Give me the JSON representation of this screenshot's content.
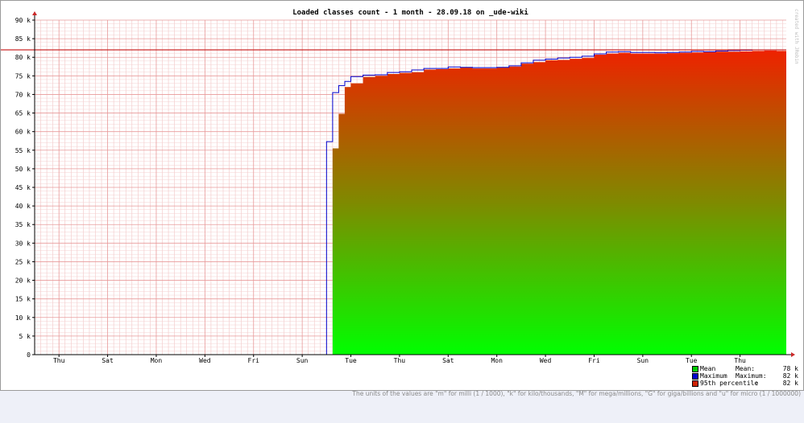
{
  "chart_data": {
    "type": "area",
    "title": "Loaded classes count - 1 month - 28.09.18 on _ude-wiki",
    "xlabel": "",
    "ylabel": "",
    "ylim": [
      0,
      90000
    ],
    "y_ticks": [
      0,
      5000,
      10000,
      15000,
      20000,
      25000,
      30000,
      35000,
      40000,
      45000,
      50000,
      55000,
      60000,
      65000,
      70000,
      75000,
      80000,
      85000,
      90000
    ],
    "y_tick_labels": [
      "0",
      "5 k",
      "10 k",
      "15 k",
      "20 k",
      "25 k",
      "30 k",
      "35 k",
      "40 k",
      "45 k",
      "50 k",
      "55 k",
      "60 k",
      "65 k",
      "70 k",
      "75 k",
      "80 k",
      "85 k",
      "90 k"
    ],
    "x_range_days": [
      0,
      30.9
    ],
    "x_ticks": [
      {
        "day": 1,
        "label": "Thu"
      },
      {
        "day": 3,
        "label": "Sat"
      },
      {
        "day": 5,
        "label": "Mon"
      },
      {
        "day": 7,
        "label": "Wed"
      },
      {
        "day": 9,
        "label": "Fri"
      },
      {
        "day": 11,
        "label": "Sun"
      },
      {
        "day": 13,
        "label": "Tue"
      },
      {
        "day": 15,
        "label": "Thu"
      },
      {
        "day": 17,
        "label": "Sat"
      },
      {
        "day": 19,
        "label": "Mon"
      },
      {
        "day": 21,
        "label": "Wed"
      },
      {
        "day": 23,
        "label": "Fri"
      },
      {
        "day": 25,
        "label": "Sun"
      },
      {
        "day": 27,
        "label": "Tue"
      },
      {
        "day": 29,
        "label": "Thu"
      }
    ],
    "percentile_95": 82000,
    "series": [
      {
        "name": "Mean",
        "color": "#00cc00",
        "x": [
          12.25,
          12.5,
          12.75,
          13.0,
          13.5,
          14.0,
          14.5,
          15.0,
          15.5,
          16.0,
          16.5,
          17.0,
          17.5,
          18.0,
          18.5,
          19.0,
          19.5,
          20.0,
          20.5,
          21.0,
          21.5,
          22.0,
          22.5,
          23.0,
          23.5,
          24.0,
          24.5,
          25.0,
          25.5,
          26.0,
          26.5,
          27.0,
          27.5,
          28.0,
          28.5,
          29.0,
          29.5,
          30.0,
          30.5
        ],
        "y": [
          55500,
          64800,
          72000,
          73000,
          74700,
          75000,
          75500,
          75800,
          76000,
          76700,
          76800,
          77000,
          77200,
          77000,
          77000,
          77200,
          77500,
          78300,
          78700,
          79200,
          79300,
          79600,
          79800,
          80700,
          81000,
          81200,
          81000,
          81000,
          81000,
          81100,
          81200,
          81300,
          81400,
          81500,
          81500,
          81600,
          81700,
          81800,
          81700
        ]
      },
      {
        "name": "Maximum",
        "color": "#0000cc",
        "x": [
          12.0,
          12.25,
          12.5,
          12.75,
          13.0,
          13.5,
          14.0,
          14.5,
          15.0,
          15.5,
          16.0,
          16.5,
          17.0,
          17.5,
          18.0,
          18.5,
          19.0,
          19.5,
          20.0,
          20.5,
          21.0,
          21.5,
          22.0,
          22.5,
          23.0,
          23.5,
          24.0,
          24.5,
          25.0,
          25.5,
          26.0,
          26.5,
          27.0,
          27.5,
          28.0,
          28.5,
          29.0,
          29.5,
          30.0,
          30.5
        ],
        "y": [
          57300,
          70500,
          72400,
          73500,
          74800,
          75200,
          75300,
          75900,
          76100,
          76600,
          77000,
          77000,
          77400,
          77300,
          77200,
          77200,
          77300,
          77700,
          78500,
          79200,
          79500,
          79800,
          80000,
          80300,
          80900,
          81400,
          81500,
          81300,
          81300,
          81200,
          81300,
          81400,
          81600,
          81500,
          81700,
          81800,
          81900,
          82000,
          82000,
          82000
        ]
      }
    ],
    "legend": [
      {
        "label": "Mean",
        "stat": "Mean:",
        "value": "78 k",
        "color": "#00cc00"
      },
      {
        "label": "Maximum",
        "stat": "Maximum:",
        "value": "82 k",
        "color": "#0000cc"
      },
      {
        "label": "95th percentile",
        "stat": ":",
        "value": "82 k",
        "color": "#cc2200"
      }
    ]
  },
  "footnote": "The units of the values are \"m\" for milli (1 / 1000), \"k\" for kilo/thousands, \"M\" for mega/millions, \"G\" for giga/billions and \"u\" for micro (1 / 1000000)",
  "watermark": "created with JRobin"
}
